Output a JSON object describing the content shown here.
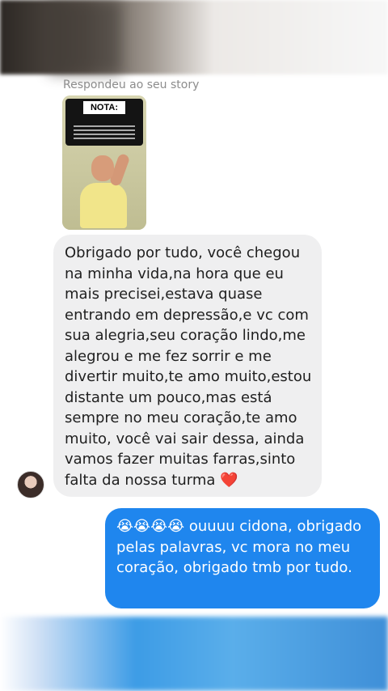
{
  "header": {
    "reply_label": "Respondeu ao seu story"
  },
  "story": {
    "note_title": "NOTA:"
  },
  "messages": [
    {
      "sender": "other",
      "text": "Obrigado por tudo, você chegou na minha vida,na hora que eu mais precisei,estava quase entrando em depressão,e vc com sua alegria,seu coração lindo,me alegrou e me fez sorrir e me divertir muito,te amo muito,estou distante um pouco,mas está sempre no meu coração,te amo muito, você vai sair dessa, ainda vamos fazer muitas farras,sinto falta da nossa turma",
      "emoji": "❤️"
    },
    {
      "sender": "me",
      "emoji": "😭😭😭😭",
      "text": "ouuuu cidona, obrigado pelas palavras, vc mora no meu coração, obrigado tmb por tudo."
    }
  ],
  "colors": {
    "sent_bubble": "#1f86ee",
    "received_bubble": "#efeff0",
    "heart": "#e02031"
  }
}
